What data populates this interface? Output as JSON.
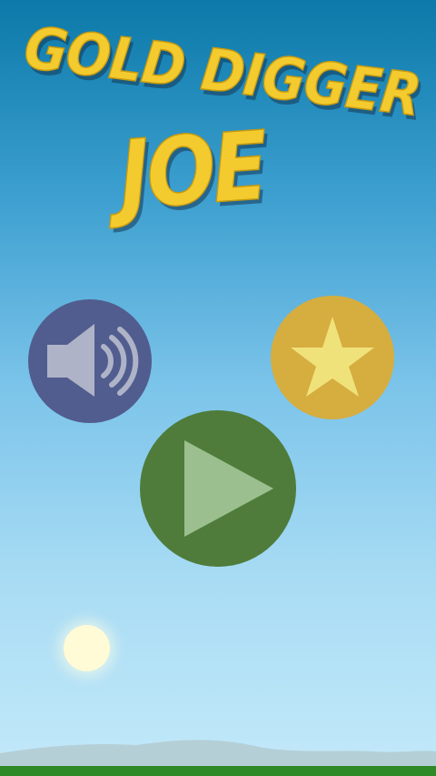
{
  "title": {
    "line1": "GOLD DIGGER",
    "line2": "JOE"
  },
  "buttons": {
    "sound": {
      "icon": "speaker-icon",
      "color": "#515d8e"
    },
    "rate": {
      "icon": "star-icon",
      "color": "#d6ad3f"
    },
    "play": {
      "icon": "play-icon",
      "color": "#4f7c3a"
    }
  },
  "colors": {
    "title": "#f3cb2e",
    "sky_top": "#0b79a9",
    "sky_bottom": "#c3e9fa",
    "ground": "#2d8a26"
  }
}
